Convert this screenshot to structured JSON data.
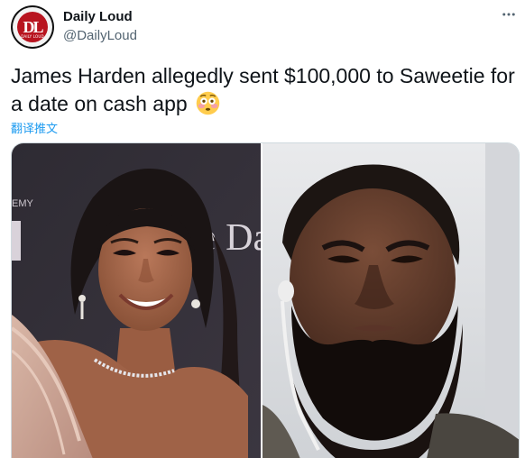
{
  "account": {
    "display_name": "Daily Loud",
    "handle": "@DailyLoud",
    "avatar_logo_text": "DL",
    "avatar_sub_text": "DAILY LOUD"
  },
  "tweet": {
    "text": "James Harden allegedly sent $100,000 to Saweetie for a date on cash app",
    "emoji": "flushed-face-emoji",
    "translate_label": "翻译推文"
  },
  "media": {
    "left_backdrop_text": "e Da",
    "left_backdrop_small_text": "EMY"
  },
  "icons": {
    "more": "more-options-icon"
  },
  "colors": {
    "link": "#1d9bf0",
    "secondary_text": "#536471",
    "primary_text": "#0f1419",
    "brand_red": "#b8141f"
  }
}
